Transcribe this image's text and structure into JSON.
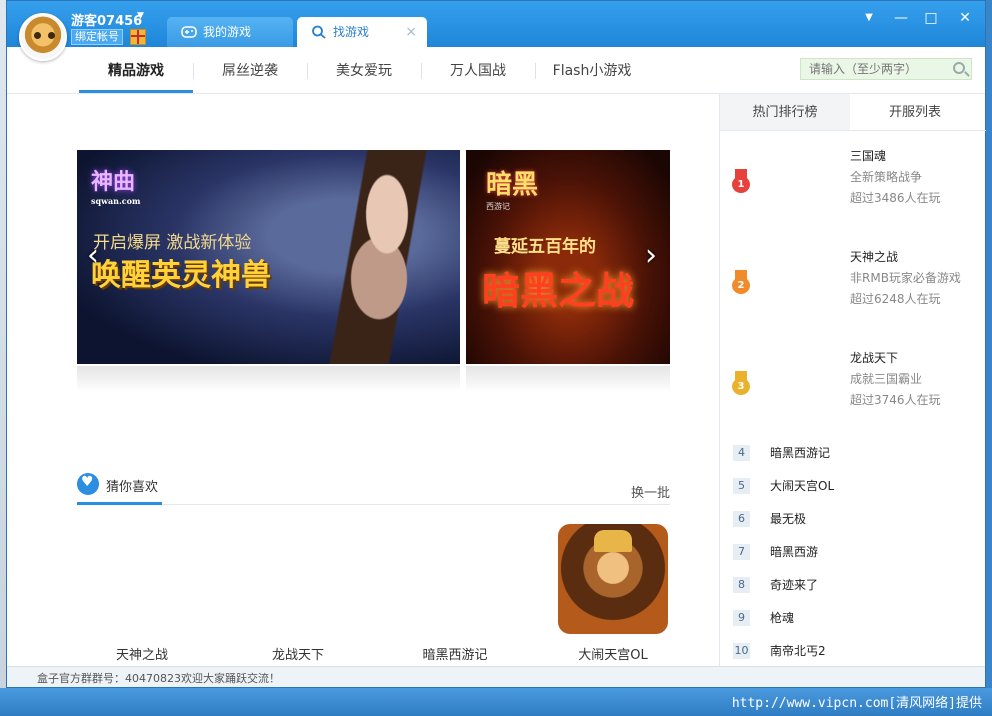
{
  "user": {
    "name": "游客07456",
    "bind_label": "绑定帐号"
  },
  "tabs": [
    {
      "label": "我的游戏"
    },
    {
      "label": "找游戏"
    }
  ],
  "tab_close": "×",
  "window_controls": {
    "menu": "▼",
    "minimize": "—",
    "maximize": "□",
    "close": "✕"
  },
  "nav": {
    "items": [
      {
        "label": "精品游戏",
        "active": true
      },
      {
        "label": "屌丝逆袭"
      },
      {
        "label": "美女爱玩"
      },
      {
        "label": "万人国战"
      },
      {
        "label": "Flash小游戏"
      }
    ],
    "search_placeholder": "请输入（至少两字）"
  },
  "banners": [
    {
      "logo": "神曲",
      "logo_small": "sqwan.com",
      "sub": "开启爆屏 激战新体验",
      "main": "唤醒英灵神兽"
    },
    {
      "logo": "暗黑",
      "logo_small": "西游记",
      "sub": "蔓延五百年的",
      "main": "暗黑之战"
    }
  ],
  "arrows": {
    "prev": "‹",
    "next": "›"
  },
  "guess": {
    "title": "猜你喜欢",
    "refresh": "换一批",
    "games": [
      "天神之战",
      "龙战天下",
      "暗黑西游记",
      "大闹天宫OL"
    ]
  },
  "right_panel": {
    "tabs": [
      "热门排行榜",
      "开服列表"
    ],
    "top": [
      {
        "rank": "1",
        "name": "三国魂",
        "desc": "全新策略战争",
        "count": "超过3486人在玩",
        "color": "#e8413c"
      },
      {
        "rank": "2",
        "name": "天神之战",
        "desc": "非RMB玩家必备游戏",
        "count": "超过6248人在玩",
        "color": "#f08a2a"
      },
      {
        "rank": "3",
        "name": "龙战天下",
        "desc": "成就三国霸业",
        "count": "超过3746人在玩",
        "color": "#e9b22a"
      }
    ],
    "list": [
      {
        "rank": "4",
        "name": "暗黑西游记"
      },
      {
        "rank": "5",
        "name": "大闹天宫OL"
      },
      {
        "rank": "6",
        "name": "最无极"
      },
      {
        "rank": "7",
        "name": "暗黑西游"
      },
      {
        "rank": "8",
        "name": "奇迹来了"
      },
      {
        "rank": "9",
        "name": "枪魂"
      },
      {
        "rank": "10",
        "name": "南帝北丐2"
      }
    ]
  },
  "footer": "盒子官方群群号：40470823欢迎大家踊跃交流！",
  "watermark": "http://www.vipcn.com[清风网络]提供"
}
